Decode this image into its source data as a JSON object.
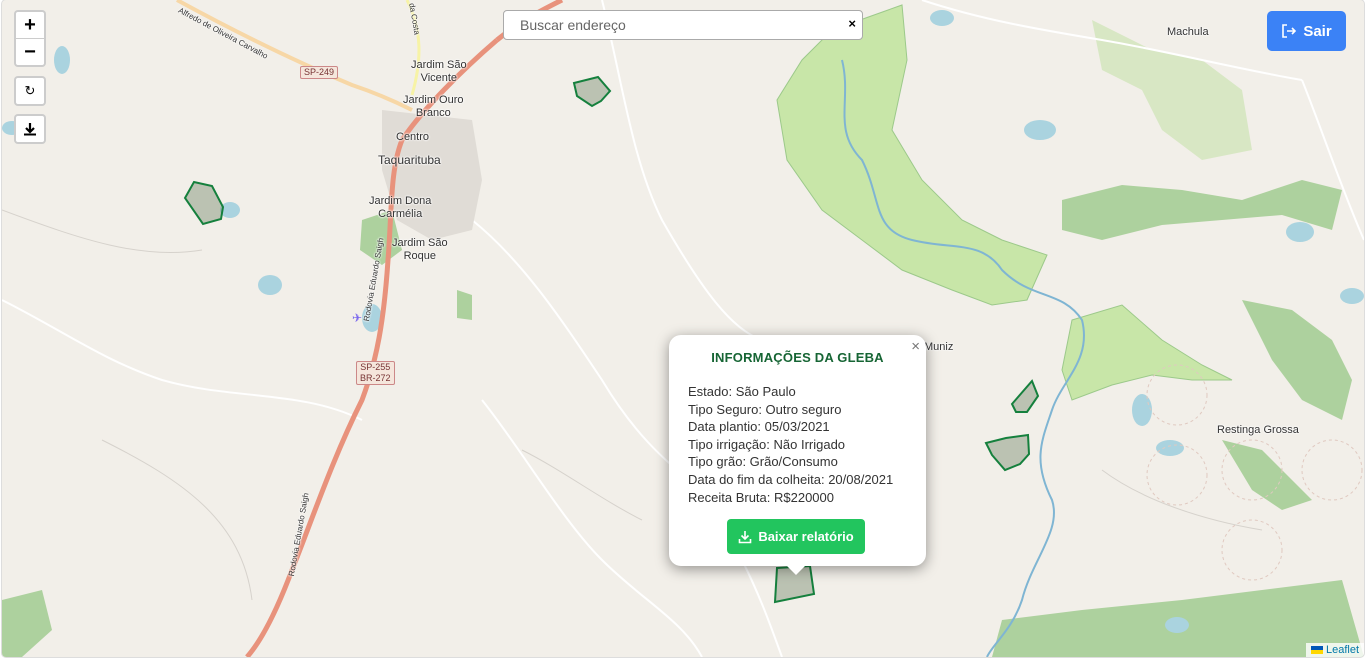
{
  "map": {
    "places": [
      {
        "id": "jardim-sao-vicente",
        "name": "Jardim São\nVicente"
      },
      {
        "id": "jardim-ouro-branco",
        "name": "Jardim Ouro\nBranco"
      },
      {
        "id": "centro",
        "name": "Centro"
      },
      {
        "id": "taquarituba",
        "name": "Taquarituba"
      },
      {
        "id": "jardim-dona-carmelia",
        "name": "Jardim Dona\nCarmélia"
      },
      {
        "id": "jardim-sao-roque",
        "name": "Jardim São\nRoque"
      },
      {
        "id": "machula",
        "name": "Machula"
      },
      {
        "id": "muniz",
        "name": "Muniz"
      },
      {
        "id": "restinga-grossa",
        "name": "Restinga Grossa"
      }
    ],
    "roads": {
      "sp249": "SP-249",
      "sp255_br272": "SP-255\nBR-272",
      "rodovia_top": "Rodovia Eduardo Saigh",
      "rodovia_bottom": "Rodovia Eduardo Saigh",
      "alfredo": "Alfredo de Oliveira Carvalho",
      "costa": "da Costa"
    },
    "colors": {
      "background": "#f2efe9",
      "water": "#aad3df",
      "wetland": "#c8e6a8",
      "forest": "#add19e",
      "parcel_fill": "rgba(120,140,110,0.45)",
      "parcel_stroke": "#15803d",
      "motorway": "#e8927c"
    }
  },
  "controls": {
    "zoom_in": "+",
    "zoom_out": "−",
    "refresh_icon": "↻",
    "download_icon": "download-icon"
  },
  "search": {
    "placeholder": "Buscar endereço",
    "clear": "×"
  },
  "logout": {
    "label": "Sair",
    "icon": "logout-icon",
    "color": "#3b82f6"
  },
  "popup": {
    "title": "INFORMAÇÕES DA GLEBA",
    "close": "×",
    "lines": [
      "Estado: São Paulo",
      "Tipo Seguro: Outro seguro",
      "Data plantio: 05/03/2021",
      "Tipo irrigação: Não Irrigado",
      "Tipo grão: Grão/Consumo",
      "Data do fim da colheita: 20/08/2021",
      "Receita Bruta: R$220000"
    ],
    "button": "Baixar relatório",
    "button_color": "#22c55e",
    "title_color": "#166534"
  },
  "attribution": {
    "label": "Leaflet"
  }
}
